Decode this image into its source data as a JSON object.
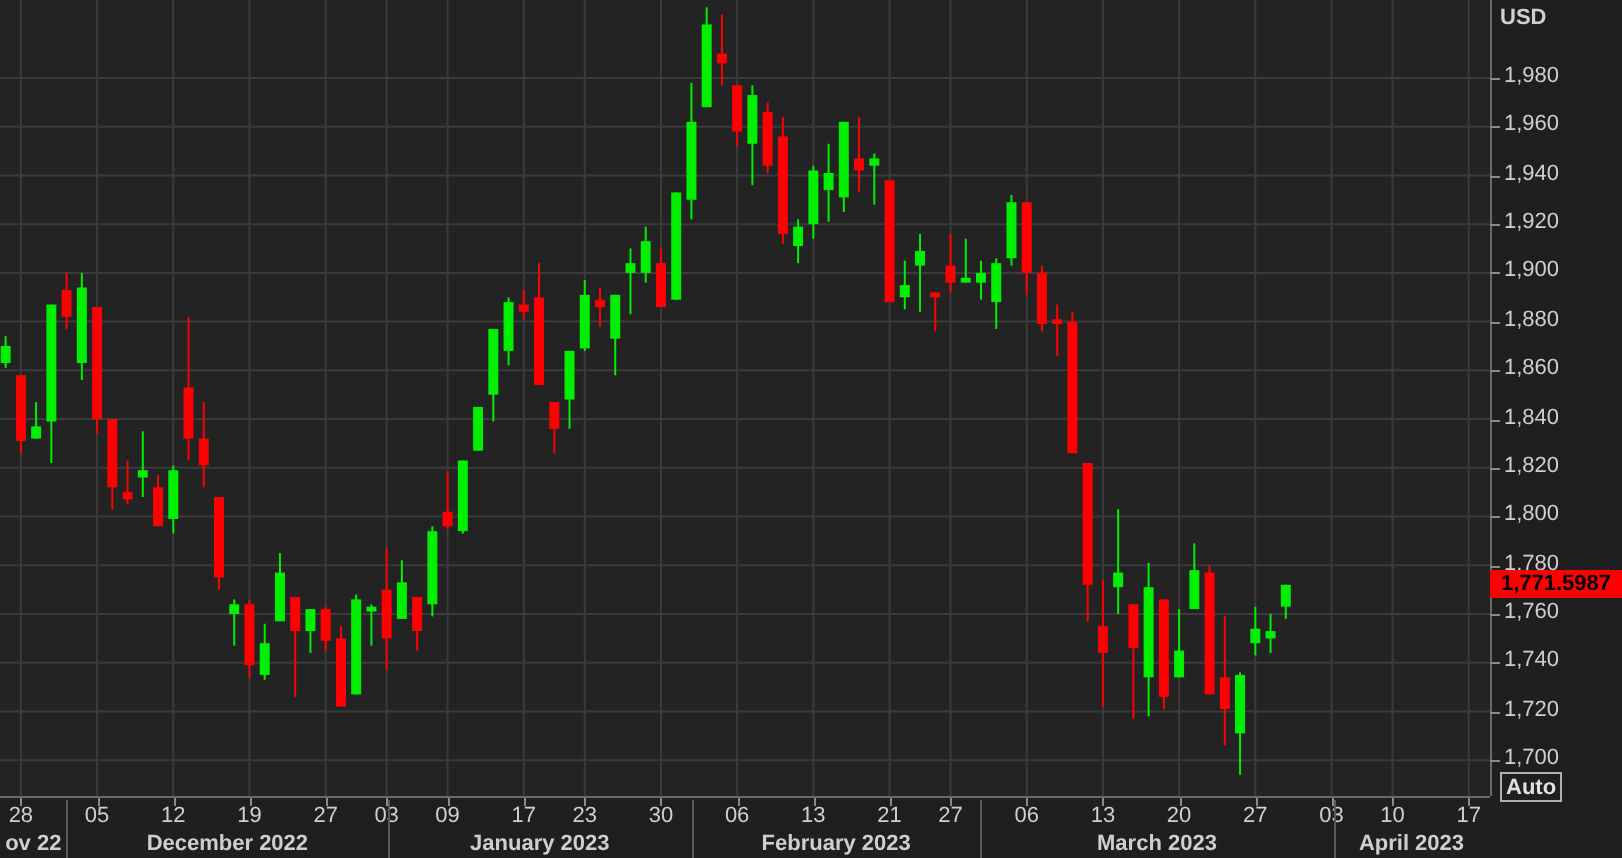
{
  "chart": {
    "chart_data": {
      "type": "candlestick",
      "ylabel": "USD",
      "grid": true,
      "categories": [
        null,
        "28",
        null,
        null,
        null,
        null,
        "05",
        null,
        null,
        null,
        null,
        "12",
        null,
        null,
        null,
        null,
        "19",
        null,
        null,
        null,
        null,
        "27",
        null,
        null,
        null,
        "03",
        null,
        null,
        null,
        "09",
        null,
        null,
        null,
        null,
        "17",
        null,
        null,
        null,
        "23",
        null,
        null,
        null,
        null,
        "30",
        null,
        null,
        null,
        null,
        "06",
        null,
        null,
        null,
        null,
        "13",
        null,
        null,
        null,
        null,
        "21",
        null,
        null,
        null,
        "27",
        null,
        null,
        null,
        null,
        "06",
        null,
        null,
        null,
        null,
        "13",
        null,
        null,
        null,
        null,
        "20",
        null,
        null,
        null,
        null,
        "27",
        null,
        null,
        null,
        null,
        "03",
        null,
        null,
        null,
        "10",
        null,
        null,
        null,
        null,
        "17"
      ],
      "ylim": [
        1685.3,
        2012
      ],
      "yticks": [
        {
          "value": 1700,
          "label": "1,700"
        },
        {
          "value": 1720,
          "label": "1,720"
        },
        {
          "value": 1740,
          "label": "1,740"
        },
        {
          "value": 1760,
          "label": "1,760"
        },
        {
          "value": 1780,
          "label": "1,780"
        },
        {
          "value": 1800,
          "label": "1,800"
        },
        {
          "value": 1820,
          "label": "1,820"
        },
        {
          "value": 1840,
          "label": "1,840"
        },
        {
          "value": 1860,
          "label": "1,860"
        },
        {
          "value": 1880,
          "label": "1,880"
        },
        {
          "value": 1900,
          "label": "1,900"
        },
        {
          "value": 1920,
          "label": "1,920"
        },
        {
          "value": 1940,
          "label": "1,940"
        },
        {
          "value": 1960,
          "label": "1,960"
        },
        {
          "value": 1980,
          "label": "1,980"
        }
      ],
      "ohlc": [
        [
          1863,
          1874,
          1861,
          1870
        ],
        [
          1858,
          1858,
          1826,
          1831
        ],
        [
          1832,
          1847,
          1832,
          1837
        ],
        [
          1839,
          1887,
          1822,
          1887
        ],
        [
          1893,
          1900,
          1877,
          1882
        ],
        [
          1863,
          1900,
          1856,
          1894
        ],
        [
          1886,
          1886,
          1834,
          1840
        ],
        [
          1840,
          1840,
          1803,
          1812
        ],
        [
          1810,
          1823,
          1805,
          1807
        ],
        [
          1816,
          1835,
          1808,
          1819
        ],
        [
          1812,
          1817,
          1796,
          1796
        ],
        [
          1799,
          1821,
          1793,
          1819
        ],
        [
          1853,
          1882,
          1823,
          1832
        ],
        [
          1832,
          1847,
          1812,
          1821
        ],
        [
          1808,
          1808,
          1770,
          1775
        ],
        [
          1760,
          1766,
          1747,
          1764
        ],
        [
          1764,
          1766,
          1734,
          1739
        ],
        [
          1735,
          1756,
          1733,
          1748
        ],
        [
          1757,
          1785,
          1757,
          1777
        ],
        [
          1767,
          1767,
          1726,
          1753
        ],
        [
          1753,
          1762,
          1744,
          1762
        ],
        [
          1762,
          1763,
          1745,
          1749
        ],
        [
          1750,
          1755,
          1722,
          1722
        ],
        [
          1727,
          1768,
          1727,
          1766
        ],
        [
          1761,
          1764,
          1747,
          1763
        ],
        [
          1770,
          1787,
          1737,
          1750
        ],
        [
          1758,
          1782,
          1758,
          1773
        ],
        [
          1767,
          1767,
          1745,
          1753
        ],
        [
          1764,
          1796,
          1759,
          1794
        ],
        [
          1802,
          1818,
          1795,
          1796
        ],
        [
          1794,
          1823,
          1793,
          1823
        ],
        [
          1827,
          1845,
          1827,
          1845
        ],
        [
          1850,
          1877,
          1839,
          1877
        ],
        [
          1868,
          1890,
          1862,
          1888
        ],
        [
          1887,
          1893,
          1881,
          1884
        ],
        [
          1890,
          1904,
          1854,
          1854
        ],
        [
          1847,
          1847,
          1826,
          1836
        ],
        [
          1848,
          1868,
          1836,
          1868
        ],
        [
          1869,
          1897,
          1868,
          1891
        ],
        [
          1889,
          1894,
          1878,
          1886
        ],
        [
          1873,
          1891,
          1858,
          1891
        ],
        [
          1900,
          1910,
          1883,
          1904
        ],
        [
          1900,
          1919,
          1896,
          1913
        ],
        [
          1904,
          1910,
          1886,
          1886
        ],
        [
          1889,
          1933,
          1889,
          1933
        ],
        [
          1930,
          1978,
          1922,
          1962
        ],
        [
          1968,
          2009,
          1968,
          2002
        ],
        [
          1990,
          2006,
          1977,
          1986
        ],
        [
          1977,
          1977,
          1952,
          1958
        ],
        [
          1953,
          1977,
          1936,
          1973
        ],
        [
          1966,
          1970,
          1941,
          1944
        ],
        [
          1956,
          1964,
          1912,
          1916
        ],
        [
          1911,
          1922,
          1904,
          1919
        ],
        [
          1920,
          1944,
          1914,
          1942
        ],
        [
          1934,
          1953,
          1921,
          1941
        ],
        [
          1931,
          1962,
          1925,
          1962
        ],
        [
          1947,
          1964,
          1933,
          1942
        ],
        [
          1944,
          1949,
          1928,
          1947
        ],
        [
          1938,
          1938,
          1888,
          1888
        ],
        [
          1890,
          1905,
          1885,
          1895
        ],
        [
          1903,
          1916,
          1884,
          1909
        ],
        [
          1892,
          1892,
          1876,
          1890
        ],
        [
          1903,
          1916,
          1892,
          1896
        ],
        [
          1896,
          1914,
          1896,
          1898
        ],
        [
          1896,
          1905,
          1889,
          1900
        ],
        [
          1888,
          1906,
          1877,
          1904
        ],
        [
          1906,
          1932,
          1903,
          1929
        ],
        [
          1929,
          1929,
          1891,
          1900
        ],
        [
          1900,
          1903,
          1876,
          1879
        ],
        [
          1881,
          1887,
          1866,
          1879
        ],
        [
          1880,
          1884,
          1826,
          1826
        ],
        [
          1822,
          1822,
          1757,
          1772
        ],
        [
          1755,
          1774,
          1722,
          1744
        ],
        [
          1771,
          1803,
          1760,
          1777
        ],
        [
          1764,
          1764,
          1717,
          1746
        ],
        [
          1734,
          1781,
          1718,
          1771
        ],
        [
          1766,
          1766,
          1721,
          1726
        ],
        [
          1734,
          1762,
          1734,
          1745
        ],
        [
          1762,
          1789,
          1762,
          1778
        ],
        [
          1777,
          1780,
          1727,
          1727
        ],
        [
          1734,
          1759,
          1706,
          1721
        ],
        [
          1711,
          1736,
          1694,
          1735
        ],
        [
          1748,
          1763,
          1743,
          1754
        ],
        [
          1750,
          1760,
          1744,
          1753
        ],
        [
          1763,
          1772,
          1758,
          1772
        ],
        null,
        null,
        null,
        null,
        null,
        null,
        null,
        null,
        null,
        null,
        null,
        null
      ]
    },
    "month_labels": [
      "ov 22",
      "December 2022",
      "January 2023",
      "February 2023",
      "March 2023",
      "April 2023"
    ],
    "last_price": {
      "label": "1,771.5987"
    },
    "auto_button": {
      "label": "Auto"
    }
  }
}
